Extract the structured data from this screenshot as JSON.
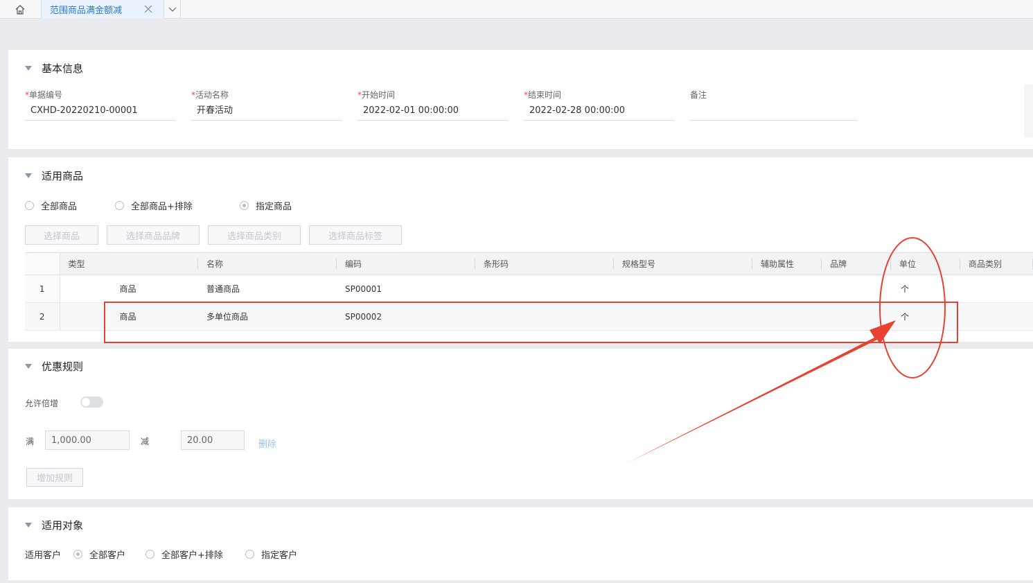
{
  "tabs": {
    "active_label": "范围商品满金额减"
  },
  "basic": {
    "title": "基本信息",
    "fields": [
      {
        "label": "单据编号",
        "value": "CXHD-20220210-00001",
        "required": "*"
      },
      {
        "label": "活动名称",
        "value": "开春活动",
        "required": "*"
      },
      {
        "label": "开始时间",
        "value": "2022-02-01 00:00:00",
        "required": "*"
      },
      {
        "label": "结束时间",
        "value": "2022-02-28 00:00:00",
        "required": "*"
      },
      {
        "label": "备注",
        "value": ""
      }
    ]
  },
  "goods": {
    "title": "适用商品",
    "radios": [
      "全部商品",
      "全部商品+排除",
      "指定商品"
    ],
    "selected_radio": "指定商品",
    "buttons": [
      "选择商品",
      "选择商品品牌",
      "选择商品类别",
      "选择商品标签"
    ],
    "columns": [
      "类型",
      "名称",
      "编码",
      "条形码",
      "规格型号",
      "辅助属性",
      "品牌",
      "单位",
      "商品类别"
    ],
    "rows": [
      {
        "idx": "1",
        "type": "商品",
        "name": "普通商品",
        "code": "SP00001",
        "unit": "个"
      },
      {
        "idx": "2",
        "type": "商品",
        "name": "多单位商品",
        "code": "SP00002",
        "unit": "个"
      }
    ]
  },
  "rules": {
    "title": "优惠规则",
    "allow_multiple_label": "允许倍增",
    "allow_multiple": false,
    "full_label": "满",
    "full_value": "1,000.00",
    "minus_label": "减",
    "minus_value": "20.00",
    "delete_label": "删除",
    "add_rule_label": "增加规则"
  },
  "target": {
    "title": "适用对象",
    "customer_label": "适用客户",
    "radios": [
      "全部客户",
      "全部客户+排除",
      "指定客户"
    ],
    "selected_radio": "全部客户"
  },
  "colors": {
    "accent": "#2b7ad6",
    "annotation": "#e8412f"
  }
}
